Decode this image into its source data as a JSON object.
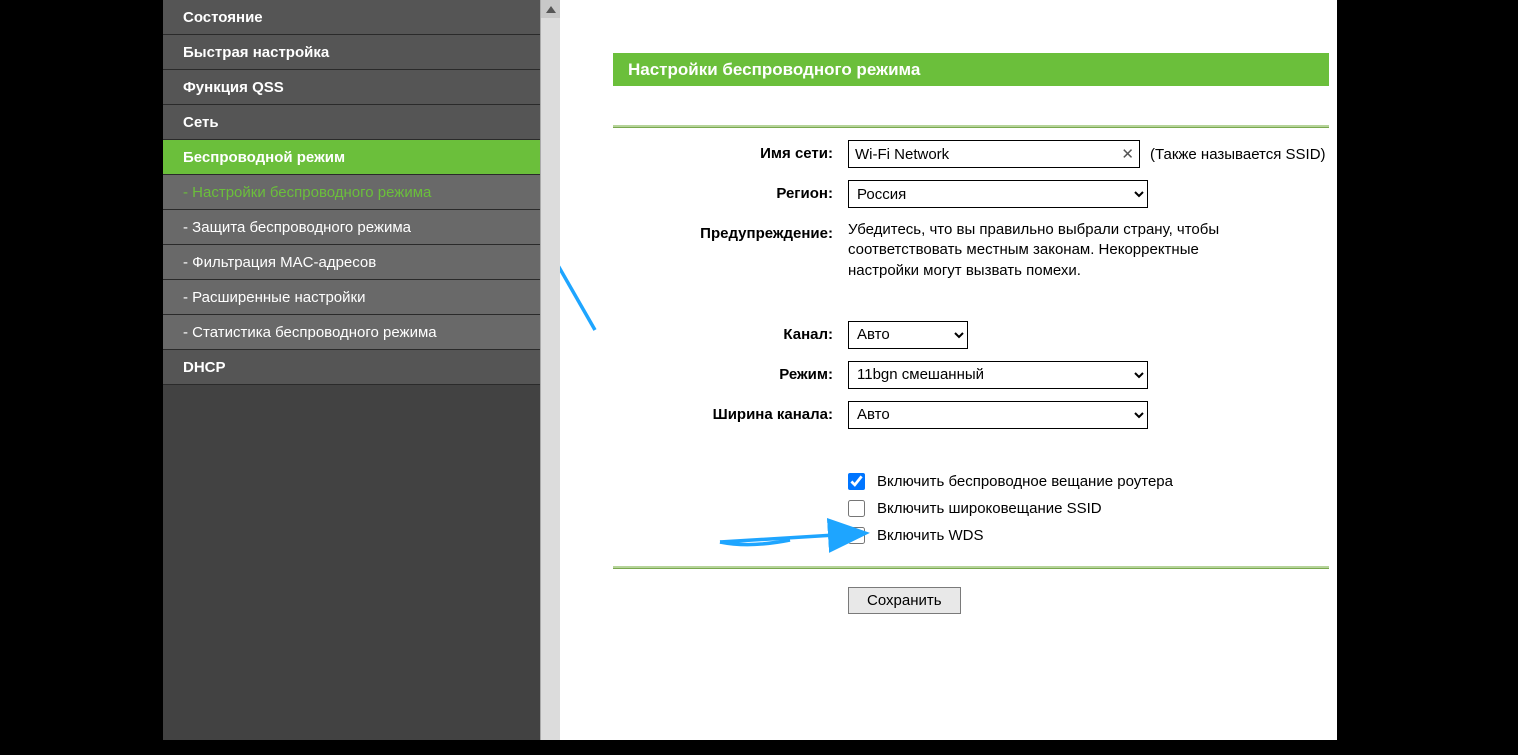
{
  "sidebar": {
    "items": [
      {
        "label": "Состояние",
        "type": "nav"
      },
      {
        "label": "Быстрая настройка",
        "type": "nav"
      },
      {
        "label": "Функция QSS",
        "type": "nav"
      },
      {
        "label": "Сеть",
        "type": "nav"
      },
      {
        "label": "Беспроводной режим",
        "type": "nav",
        "active": true
      },
      {
        "label": "- Настройки беспроводного режима",
        "type": "sub",
        "current": true
      },
      {
        "label": "- Защита беспроводного режима",
        "type": "sub"
      },
      {
        "label": "- Фильтрация MAC-адресов",
        "type": "sub"
      },
      {
        "label": "- Расширенные настройки",
        "type": "sub"
      },
      {
        "label": "- Статистика беспроводного режима",
        "type": "sub"
      },
      {
        "label": "DHCP",
        "type": "nav"
      }
    ]
  },
  "page": {
    "title": "Настройки беспроводного режима",
    "ssid_label": "Имя сети:",
    "ssid_value": "Wi-Fi Network",
    "ssid_hint": "(Также называется SSID)",
    "region_label": "Регион:",
    "region_value": "Россия",
    "warning_label": "Предупреждение:",
    "warning_text": "Убедитесь, что вы правильно выбрали страну, чтобы соответствовать местным законам. Некорректные настройки могут вызвать помехи.",
    "channel_label": "Канал:",
    "channel_value": "Авто",
    "mode_label": "Режим:",
    "mode_value": "11bgn смешанный",
    "width_label": "Ширина канала:",
    "width_value": "Авто",
    "chk_radio": "Включить беспроводное вещание роутера",
    "chk_ssid": "Включить широковещание SSID",
    "chk_wds": "Включить WDS",
    "save": "Сохранить"
  },
  "colors": {
    "accent": "#6bbf3b",
    "annotation": "#1ea5ff"
  }
}
